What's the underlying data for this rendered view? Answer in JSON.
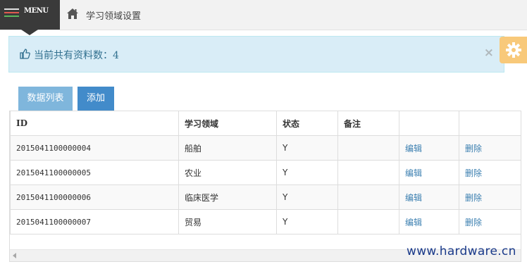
{
  "menu": {
    "label": "MENU"
  },
  "breadcrumb": {
    "title": "学习领域设置",
    "icon": "home-icon"
  },
  "alert": {
    "text": "当前共有资料数：4",
    "icon": "thumbs-up-icon",
    "close": "×"
  },
  "settings": {
    "icon": "gear-icon",
    "color": "#f8c97a"
  },
  "tabs": {
    "list_label": "数据列表",
    "add_label": "添加"
  },
  "table": {
    "headers": [
      "ID",
      "学习领域",
      "状态",
      "备注",
      "",
      ""
    ],
    "rows": [
      {
        "id": "2015041100000004",
        "field": "船舶",
        "status": "Y",
        "note": "",
        "edit": "编辑",
        "delete": "删除"
      },
      {
        "id": "2015041100000005",
        "field": "农业",
        "status": "Y",
        "note": "",
        "edit": "编辑",
        "delete": "删除"
      },
      {
        "id": "2015041100000006",
        "field": "临床医学",
        "status": "Y",
        "note": "",
        "edit": "编辑",
        "delete": "删除"
      },
      {
        "id": "2015041100000007",
        "field": "贸易",
        "status": "Y",
        "note": "",
        "edit": "编辑",
        "delete": "删除"
      }
    ]
  },
  "watermark": "www.hardware.cn",
  "colors": {
    "alert_bg": "#d9edf7",
    "alert_text": "#31708f",
    "primary": "#428bca",
    "link": "#3b7fb0"
  }
}
